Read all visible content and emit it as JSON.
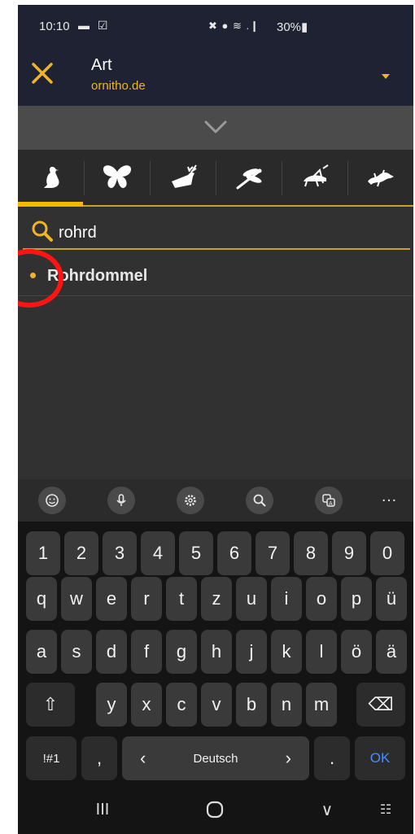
{
  "status_bar": {
    "time": "10:10",
    "left_icons": "▬ ☑",
    "right_icons": "✖ ● ≋ .❙",
    "battery": "30%▮"
  },
  "app_bar": {
    "title": "Art",
    "subtitle": "ornitho.de"
  },
  "tabs": [
    {
      "name": "bird-icon",
      "active": true
    },
    {
      "name": "butterfly-icon",
      "active": false
    },
    {
      "name": "deer-icon",
      "active": false
    },
    {
      "name": "dragonfly-icon",
      "active": false
    },
    {
      "name": "grasshopper-icon",
      "active": false
    },
    {
      "name": "lizard-icon",
      "active": false
    }
  ],
  "search": {
    "value": "rohrd"
  },
  "results": [
    {
      "label": "Rohrdommel"
    }
  ],
  "keyboard": {
    "toolbar_more": "…",
    "row_numbers": [
      "1",
      "2",
      "3",
      "4",
      "5",
      "6",
      "7",
      "8",
      "9",
      "0"
    ],
    "row_1": [
      "q",
      "w",
      "e",
      "r",
      "t",
      "z",
      "u",
      "i",
      "o",
      "p",
      "ü"
    ],
    "row_2": [
      "a",
      "s",
      "d",
      "f",
      "g",
      "h",
      "j",
      "k",
      "l",
      "ö",
      "ä"
    ],
    "row_3": [
      "y",
      "x",
      "c",
      "v",
      "b",
      "n",
      "m"
    ],
    "shift": "⇧",
    "backspace": "⌫",
    "symbols": "!#1",
    "comma": ",",
    "space_left": "‹",
    "space_label": "Deutsch",
    "space_right": "›",
    "period": ".",
    "ok": "OK"
  },
  "nav_bar": {
    "recents": "III",
    "back": "∨",
    "keyboard_switch": "☷"
  },
  "colors": {
    "accent": "#f0b429",
    "app_bar": "#1e2233",
    "highlight_circle": "#ff1414",
    "ok_blue": "#4a8cff"
  }
}
